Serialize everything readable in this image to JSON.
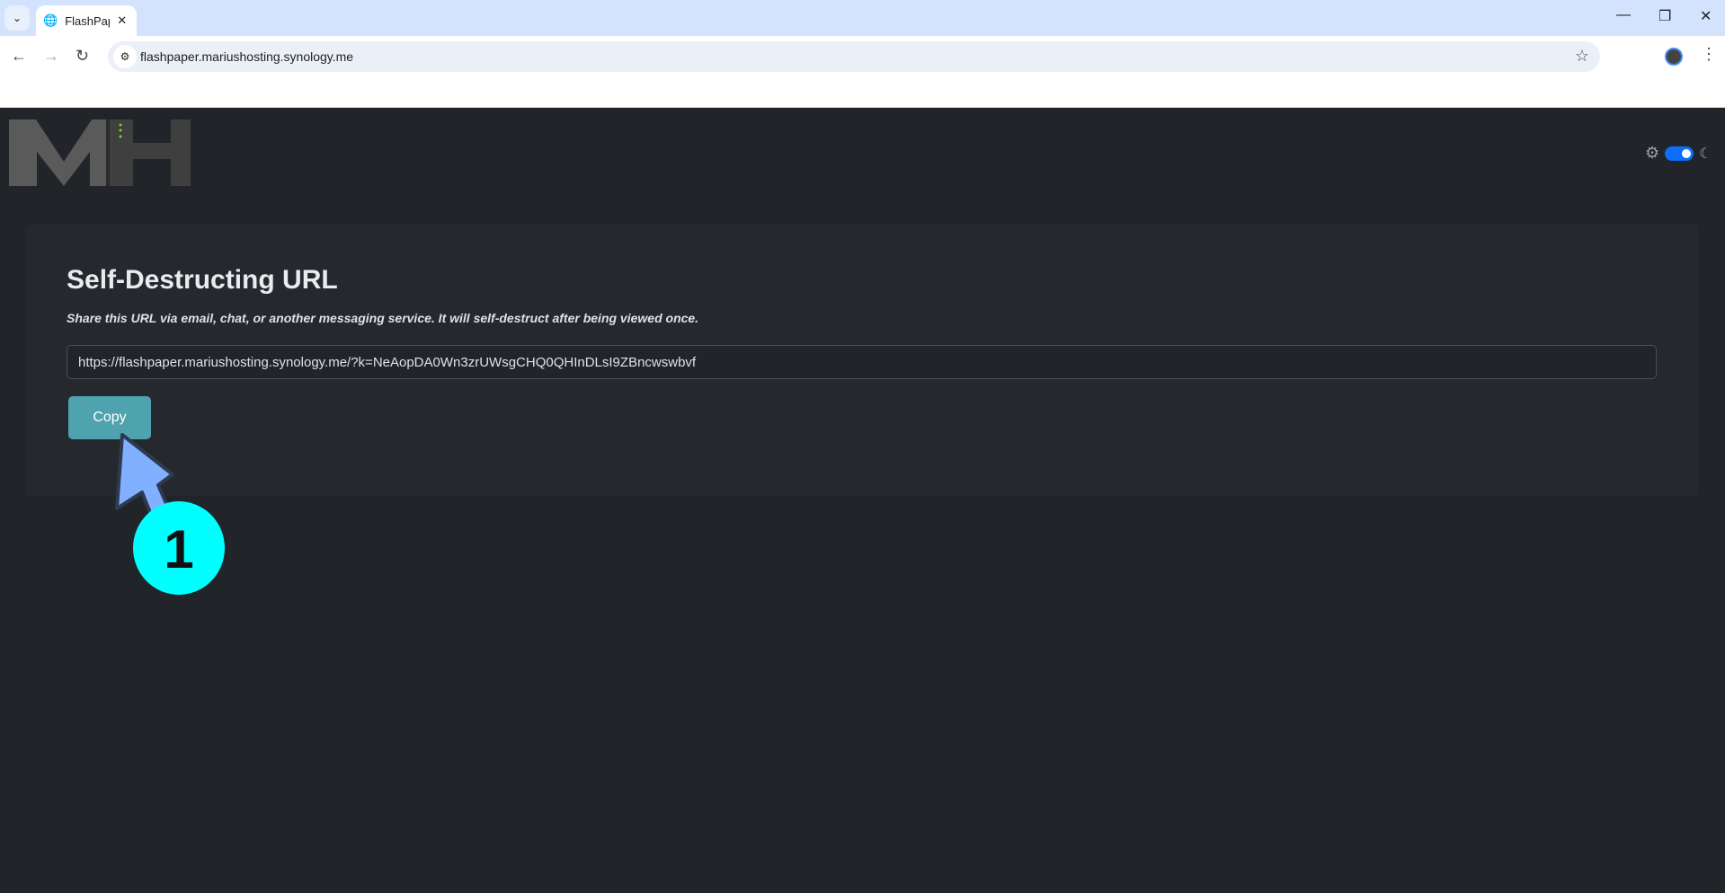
{
  "browser": {
    "tab_title": "FlashPaper",
    "url": "flashpaper.mariushosting.synology.me"
  },
  "app": {
    "logo": "MH",
    "toggle_on": true
  },
  "card": {
    "title": "Self-Destructing URL",
    "subtitle": "Share this URL via email, chat, or another messaging service. It will self-destruct after being viewed once.",
    "url_value": "https://flashpaper.mariushosting.synology.me/?k=NeAopDA0Wn3zrUWsgCHQ0QHInDLsI9ZBncwswbvf",
    "copy_label": "Copy"
  },
  "annotation": {
    "step": "1",
    "color": "#00ffff",
    "arrow_color": "#80b0ff"
  },
  "colors": {
    "accent": "#4ea3ae",
    "toggle": "#0d6efd"
  }
}
